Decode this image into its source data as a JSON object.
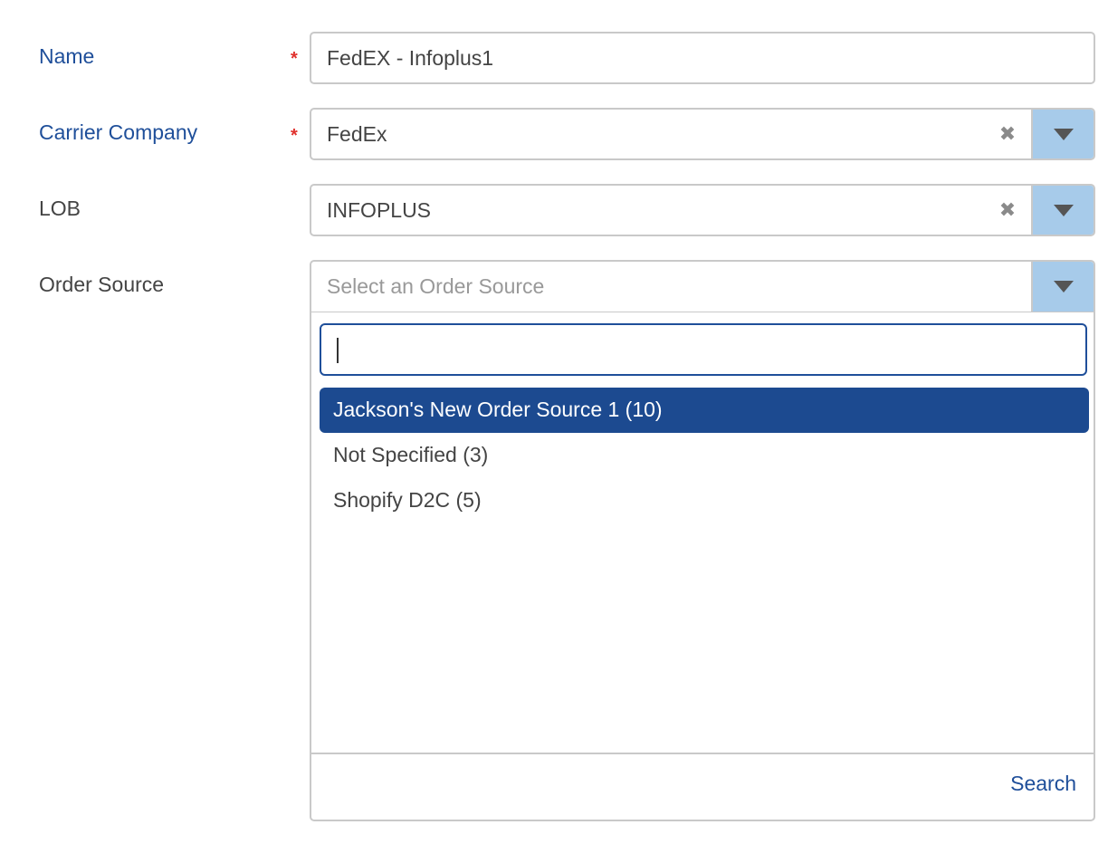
{
  "fields": {
    "name": {
      "label": "Name",
      "required_mark": "*",
      "value": "FedEX - Infoplus1"
    },
    "carrier_company": {
      "label": "Carrier Company",
      "required_mark": "*",
      "value": "FedEx",
      "clear_glyph": "✖"
    },
    "lob": {
      "label": "LOB",
      "value": "INFOPLUS",
      "clear_glyph": "✖"
    },
    "order_source": {
      "label": "Order Source",
      "placeholder": "Select an Order Source"
    }
  },
  "dropdown": {
    "search_value": "",
    "options": [
      {
        "label": "Jackson's New Order Source 1 (10)",
        "highlighted": true
      },
      {
        "label": "Not Specified (3)",
        "highlighted": false
      },
      {
        "label": "Shopify D2C (5)",
        "highlighted": false
      }
    ],
    "footer_link": "Search"
  },
  "colors": {
    "required_label": "#1f4f9a",
    "required_star": "#e0312d",
    "dropdown_button": "#a7cbea",
    "highlight": "#1c4a90",
    "link": "#1f4f9a"
  }
}
